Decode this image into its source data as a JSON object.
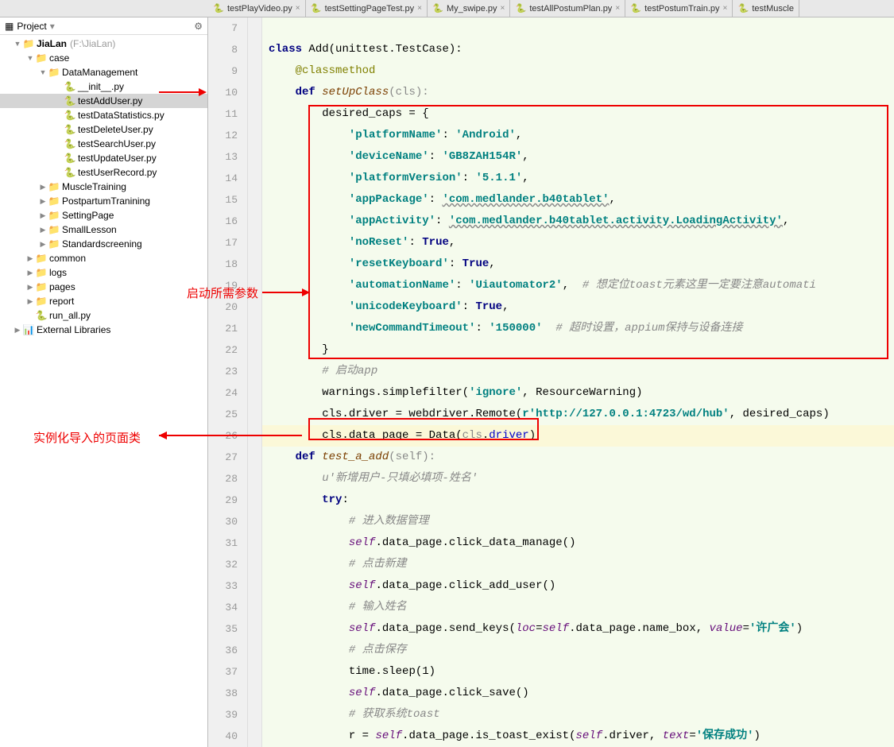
{
  "sidebar": {
    "header": "Project",
    "root": {
      "name": "JiaLan",
      "path": "(F:\\JiaLan)"
    },
    "nodes": [
      {
        "label": "case",
        "type": "folder",
        "open": true
      },
      {
        "label": "DataManagement",
        "type": "folder",
        "open": true
      },
      {
        "label": "__init__.py",
        "type": "py"
      },
      {
        "label": "testAddUser.py",
        "type": "py",
        "selected": true
      },
      {
        "label": "testDataStatistics.py",
        "type": "py"
      },
      {
        "label": "testDeleteUser.py",
        "type": "py"
      },
      {
        "label": "testSearchUser.py",
        "type": "py"
      },
      {
        "label": "testUpdateUser.py",
        "type": "py"
      },
      {
        "label": "testUserRecord.py",
        "type": "py"
      },
      {
        "label": "MuscleTraining",
        "type": "folder"
      },
      {
        "label": "PostpartumTranining",
        "type": "folder"
      },
      {
        "label": "SettingPage",
        "type": "folder"
      },
      {
        "label": "SmallLesson",
        "type": "folder"
      },
      {
        "label": "Standardscreening",
        "type": "folder"
      },
      {
        "label": "common",
        "type": "folder"
      },
      {
        "label": "logs",
        "type": "folder"
      },
      {
        "label": "pages",
        "type": "folder"
      },
      {
        "label": "report",
        "type": "folder"
      },
      {
        "label": "run_all.py",
        "type": "py"
      },
      {
        "label": "External Libraries",
        "type": "ext"
      }
    ]
  },
  "tabs": [
    "testPlayVideo.py",
    "testSettingPageTest.py",
    "My_swipe.py",
    "testAllPostumPlan.py",
    "testPostumTrain.py",
    "testMuscle"
  ],
  "lines": [
    "7",
    "8",
    "9",
    "10",
    "11",
    "12",
    "13",
    "14",
    "15",
    "16",
    "17",
    "18",
    "19",
    "20",
    "21",
    "22",
    "23",
    "24",
    "25",
    "26",
    "27",
    "28",
    "29",
    "30",
    "31",
    "32",
    "33",
    "34",
    "35",
    "36",
    "37",
    "38",
    "39",
    "40"
  ],
  "code": {
    "l8_kw": "class ",
    "l8_cls": "Add",
    "l8_base": "(unittest.TestCase):",
    "l9_deco": "@classmethod",
    "l10_kw": "def ",
    "l10_fn": "setUpClass",
    "l10_arg": "(cls):",
    "l11": "desired_caps = {",
    "l12_k": "'platformName'",
    "l12_c": ": ",
    "l12_v": "'Android'",
    "l12_e": ",",
    "l13_k": "'deviceName'",
    "l13_v": "'GB8ZAH154R'",
    "l14_k": "'platformVersion'",
    "l14_v": "'5.1.1'",
    "l15_k": "'appPackage'",
    "l15_v": "'com.medlander.b40tablet'",
    "l16_k": "'appActivity'",
    "l16_v": "'com.medlander.b40tablet.activity.LoadingActivity'",
    "l17_k": "'noReset'",
    "l17_v": "True",
    "l18_k": "'resetKeyboard'",
    "l18_v": "True",
    "l19_k": "'automationName'",
    "l19_v": "'Uiautomator2'",
    "l19_com": "# 想定位toast元素这里一定要注意automati",
    "l20_k": "'unicodeKeyboard'",
    "l20_v": "True",
    "l21_k": "'newCommandTimeout'",
    "l21_v": "'150000'",
    "l21_com": "# 超时设置，appium保持与设备连接",
    "l22": "}",
    "l23": "# 启动app",
    "l24_a": "warnings.simplefilter(",
    "l24_b": "'ignore'",
    "l24_c": ", ResourceWarning)",
    "l25_a": "cls.driver = webdriver.Remote(",
    "l25_b": "r'http://127.0.0.1:4723/wd/hub'",
    "l25_c": ", desired_caps)",
    "l26_a": "cls.data_page = Data(",
    "l26_cls": "cls",
    "l26_dot": ".",
    "l26_drv": "driver",
    "l26_b": ")",
    "l27_kw": "def ",
    "l27_fn": "test_a_add",
    "l27_arg": "(self):",
    "l28": "u'新增用户-只填必填项-姓名'",
    "l29_kw": "try",
    "l29_c": ":",
    "l30": "# 进入数据管理",
    "l31_a": "self",
    "l31_b": ".data_page.click_data_manage()",
    "l32": "# 点击新建",
    "l33_a": "self",
    "l33_b": ".data_page.click_add_user()",
    "l34": "# 输入姓名",
    "l35_a": "self",
    "l35_b": ".data_page.send_keys(",
    "l35_c": "loc",
    "l35_d": "=",
    "l35_e": "self",
    "l35_f": ".data_page.name_box, ",
    "l35_g": "value",
    "l35_h": "=",
    "l35_i": "'许广会'",
    "l35_j": ")",
    "l36": "# 点击保存",
    "l37": "time.sleep(1)",
    "l38_a": "self",
    "l38_b": ".data_page.click_save()",
    "l39": "# 获取系统toast",
    "l40_a": "r = ",
    "l40_b": "self",
    "l40_c": ".data_page.is_toast_exist(",
    "l40_d": "self",
    "l40_e": ".driver, ",
    "l40_f": "text",
    "l40_g": "=",
    "l40_h": "'保存成功'",
    "l40_i": ")"
  },
  "annotations": {
    "params": "启动所需参数",
    "instance": "实例化导入的页面类"
  }
}
